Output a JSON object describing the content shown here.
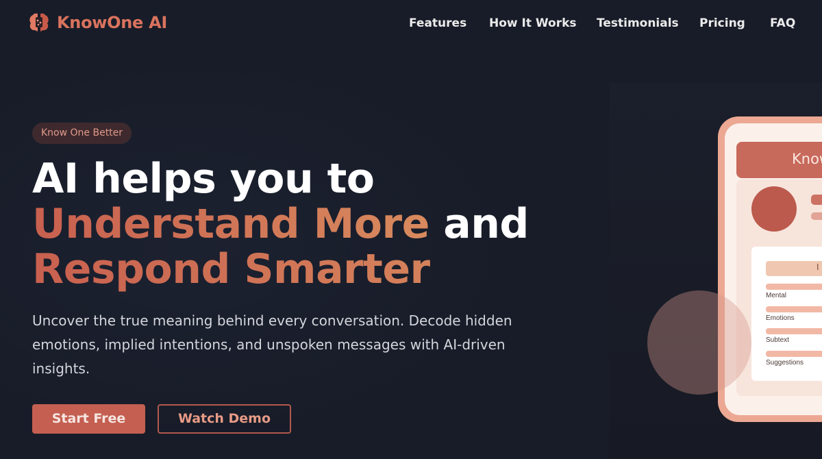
{
  "brand": {
    "name": "KnowOne AI",
    "accent": "#d9735e",
    "background": "#181c28"
  },
  "nav": {
    "links": [
      "Features",
      "How It Works",
      "Testimonials",
      "Pricing",
      "FAQ"
    ]
  },
  "hero": {
    "badge": "Know One Better",
    "headline_line1": "AI helps you to",
    "headline_highlight1": "Understand More",
    "headline_connector": " and",
    "headline_highlight2": "Respond Smarter",
    "subtitle": "Uncover the true meaning behind every conversation. Decode hidden emotions, implied intentions, and unspoken messages with AI-driven insights.",
    "primary_button": "Start Free",
    "secondary_button": "Watch Demo"
  },
  "mockup": {
    "header_text": "Know",
    "card_title": "I",
    "labels": [
      "Mental",
      "Emotions",
      "Subtext",
      "Suggestions"
    ]
  }
}
